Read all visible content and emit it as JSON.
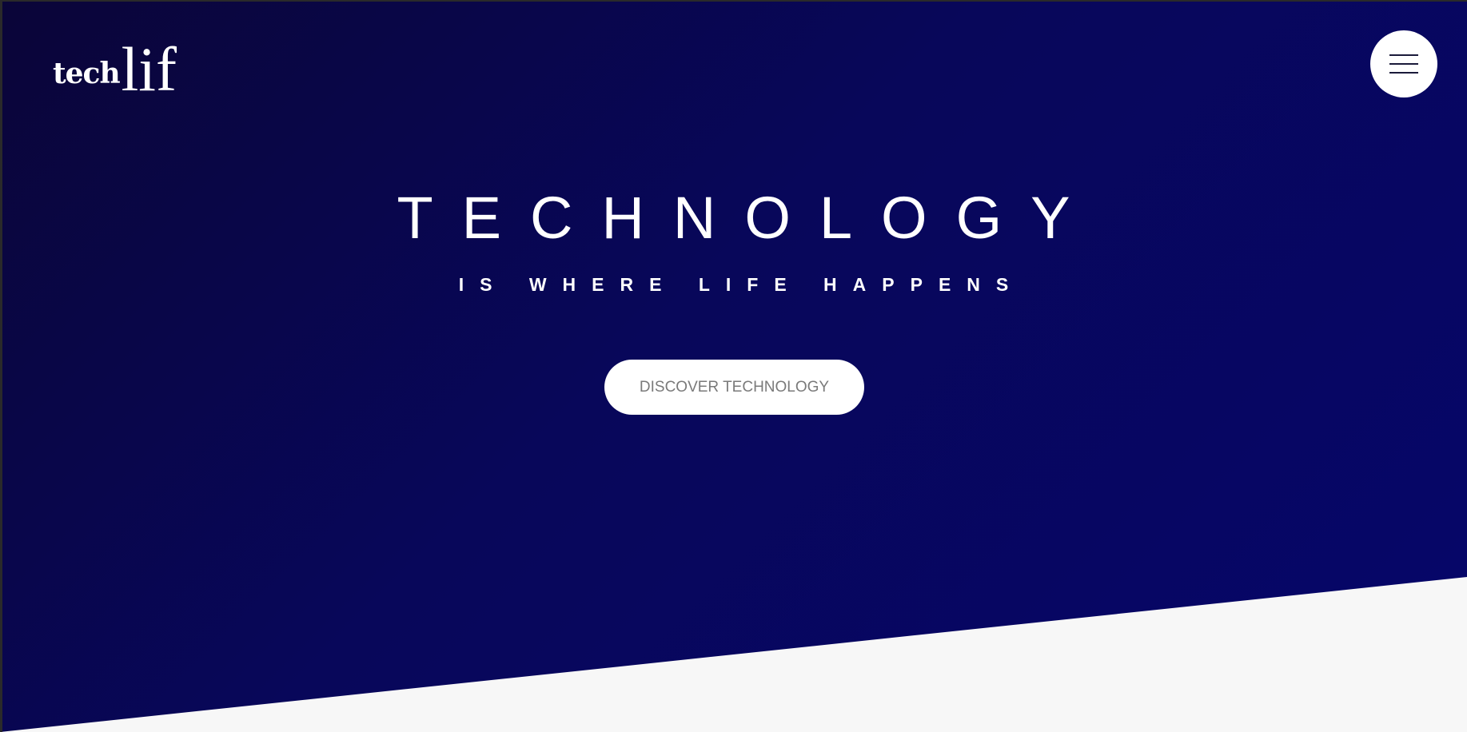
{
  "brand": {
    "logo_part1": "tech",
    "logo_part2": "lif"
  },
  "header": {
    "menu_icon": "hamburger-menu-icon"
  },
  "hero": {
    "headline": "TECHNOLOGY",
    "subheadline": "IS WHERE LIFE HAPPENS",
    "cta_label": "DISCOVER TECHNOLOGY"
  },
  "colors": {
    "hero_dark": "#0a0538",
    "hero_mid": "#08075a",
    "hero_light": "#06066a",
    "page_bg": "#f7f7f7",
    "button_bg": "#ffffff",
    "button_text": "#7a7a7a"
  }
}
